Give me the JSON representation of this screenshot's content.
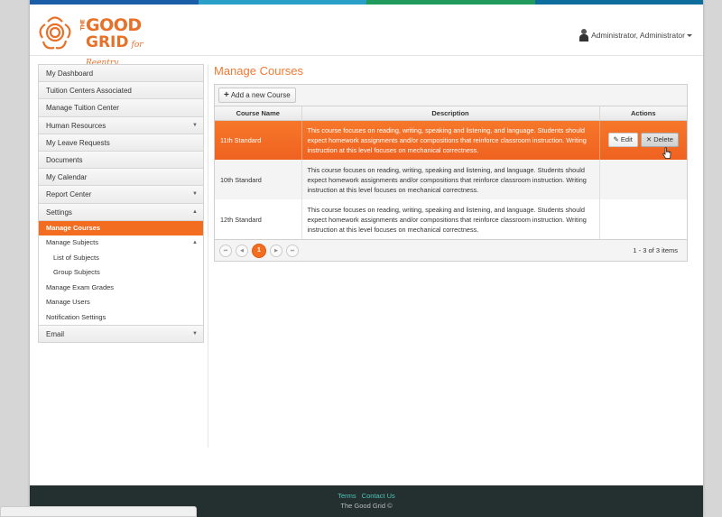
{
  "colors": {
    "accent": "#f36d21",
    "brand_teal": "#4fc3b8",
    "footer_bg": "#243030",
    "top_strip": [
      "#1a5ea8",
      "#2aa0c8",
      "#1f9a5a",
      "#0d6e9e"
    ]
  },
  "header": {
    "logo": {
      "line1": "GOOD",
      "the": "THE",
      "line2": "GRID",
      "tagline": "for Reentry"
    },
    "user_name": "Administrator, Administrator"
  },
  "sidebar": {
    "items": [
      {
        "label": "My Dashboard"
      },
      {
        "label": "Tuition Centers Associated"
      },
      {
        "label": "Manage Tuition Center"
      },
      {
        "label": "Human Resources",
        "arrow": "▼"
      },
      {
        "label": "My Leave Requests"
      },
      {
        "label": "Documents"
      },
      {
        "label": "My Calendar"
      },
      {
        "label": "Report Center",
        "arrow": "▼"
      },
      {
        "label": "Settings",
        "arrow": "▲"
      }
    ],
    "settings_sub": [
      {
        "label": "Manage Courses"
      },
      {
        "label": "Manage Subjects",
        "arrow": "▲"
      },
      {
        "label": "List of Subjects"
      },
      {
        "label": "Group Subjects"
      },
      {
        "label": "Manage Exam Grades"
      },
      {
        "label": "Manage Users"
      },
      {
        "label": "Notification Settings"
      }
    ],
    "email": {
      "label": "Email",
      "arrow": "▼"
    }
  },
  "main": {
    "title": "Manage Courses",
    "add_button": "Add a new Course",
    "columns": [
      "Course Name",
      "Description",
      "Actions"
    ],
    "rows": [
      {
        "name": "11th Standard",
        "description": "This course focuses on reading, writing, speaking and listening, and language. Students should expect homework assignments and/or compositions that reinforce classroom instruction. Writing instruction at this level focuses on mechanical correctness."
      },
      {
        "name": "10th Standard",
        "description": "This course focuses on reading, writing, speaking and listening, and language. Students should expect homework assignments and/or compositions that reinforce classroom instruction. Writing instruction at this level focuses on mechanical correctness."
      },
      {
        "name": "12th Standard",
        "description": "This course focuses on reading, writing, speaking and listening, and language. Students should expect homework assignments and/or compositions that reinforce classroom instruction. Writing instruction at this level focuses on mechanical correctness."
      }
    ],
    "edit_label": "Edit",
    "delete_label": "Delete",
    "pager": {
      "first": "⏮",
      "prev": "◀",
      "current": "1",
      "next": "▶",
      "last": "⏭",
      "info": "1 - 3 of 3 items"
    }
  },
  "footer": {
    "terms": "Terms",
    "contact": "Contact Us",
    "copyright": "The Good Grid ©"
  }
}
